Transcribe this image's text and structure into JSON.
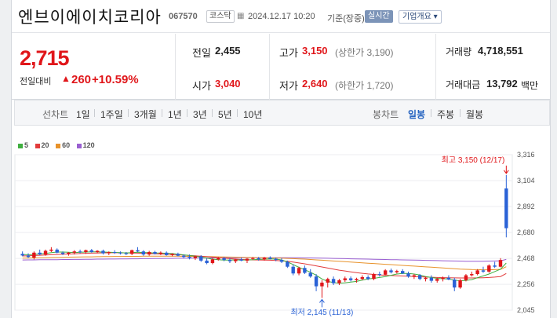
{
  "stock": {
    "name": "엔브이에이치코리아",
    "code": "067570",
    "market": "코스닥",
    "datetime": "2024.12.17 10:20",
    "basis": "기준(장중)",
    "realtime_label": "실시간",
    "corp_info_label": "기업개요 ▾"
  },
  "quote": {
    "price": "2,715",
    "change_label": "전일대비",
    "change_arrow": "▲",
    "change": "260",
    "change_pct": "+10.59%",
    "prev_close_label": "전일",
    "prev_close": "2,455",
    "open_label": "시가",
    "open": "3,040",
    "high_label": "고가",
    "high": "3,150",
    "upper_limit": "(상한가 3,190)",
    "low_label": "저가",
    "low": "2,640",
    "lower_limit": "(하한가 1,720)",
    "volume_label": "거래량",
    "volume": "4,718,551",
    "amount_label": "거래대금",
    "amount": "13,792",
    "amount_unit": "백만"
  },
  "period_bar": {
    "line_label": "선차트",
    "line_periods": [
      "1일",
      "1주일",
      "3개월",
      "1년",
      "3년",
      "5년",
      "10년"
    ],
    "candle_label": "봉차트",
    "candle_periods": [
      "일봉",
      "주봉",
      "월봉"
    ],
    "active_candle": "일봉"
  },
  "chart_data": {
    "type": "candlestick",
    "legend": [
      {
        "name": "5",
        "color": "#3fae3f"
      },
      {
        "name": "20",
        "color": "#e23b3b"
      },
      {
        "name": "60",
        "color": "#e8922a"
      },
      {
        "name": "120",
        "color": "#9a5fd1"
      }
    ],
    "y_ticks": [
      "3,316",
      "3,104",
      "2,892",
      "2,680",
      "2,468",
      "2,256",
      "2,045"
    ],
    "ylim": [
      2045,
      3316
    ],
    "max_annotation": "최고 3,150 (12/17)",
    "min_annotation": "최저 2,145 (11/13)",
    "up_color": "#e0161a",
    "down_color": "#2a62d6",
    "candles": [
      {
        "o": 2505,
        "h": 2525,
        "l": 2485,
        "c": 2492
      },
      {
        "o": 2492,
        "h": 2510,
        "l": 2470,
        "c": 2480
      },
      {
        "o": 2475,
        "h": 2525,
        "l": 2460,
        "c": 2515
      },
      {
        "o": 2515,
        "h": 2540,
        "l": 2495,
        "c": 2500
      },
      {
        "o": 2500,
        "h": 2540,
        "l": 2490,
        "c": 2530
      },
      {
        "o": 2530,
        "h": 2560,
        "l": 2520,
        "c": 2540
      },
      {
        "o": 2540,
        "h": 2550,
        "l": 2510,
        "c": 2515
      },
      {
        "o": 2515,
        "h": 2525,
        "l": 2495,
        "c": 2505
      },
      {
        "o": 2505,
        "h": 2520,
        "l": 2490,
        "c": 2515
      },
      {
        "o": 2515,
        "h": 2535,
        "l": 2500,
        "c": 2525
      },
      {
        "o": 2525,
        "h": 2540,
        "l": 2510,
        "c": 2520
      },
      {
        "o": 2520,
        "h": 2540,
        "l": 2505,
        "c": 2535
      },
      {
        "o": 2535,
        "h": 2545,
        "l": 2515,
        "c": 2520
      },
      {
        "o": 2520,
        "h": 2535,
        "l": 2510,
        "c": 2530
      },
      {
        "o": 2530,
        "h": 2540,
        "l": 2500,
        "c": 2510
      },
      {
        "o": 2510,
        "h": 2525,
        "l": 2495,
        "c": 2520
      },
      {
        "o": 2520,
        "h": 2535,
        "l": 2505,
        "c": 2515
      },
      {
        "o": 2515,
        "h": 2525,
        "l": 2500,
        "c": 2510
      },
      {
        "o": 2510,
        "h": 2520,
        "l": 2495,
        "c": 2505
      },
      {
        "o": 2505,
        "h": 2540,
        "l": 2495,
        "c": 2535
      },
      {
        "o": 2535,
        "h": 2560,
        "l": 2520,
        "c": 2525
      },
      {
        "o": 2525,
        "h": 2535,
        "l": 2490,
        "c": 2500
      },
      {
        "o": 2500,
        "h": 2530,
        "l": 2490,
        "c": 2520
      },
      {
        "o": 2520,
        "h": 2530,
        "l": 2500,
        "c": 2505
      },
      {
        "o": 2505,
        "h": 2525,
        "l": 2495,
        "c": 2515
      },
      {
        "o": 2515,
        "h": 2525,
        "l": 2490,
        "c": 2495
      },
      {
        "o": 2495,
        "h": 2510,
        "l": 2485,
        "c": 2505
      },
      {
        "o": 2505,
        "h": 2515,
        "l": 2485,
        "c": 2490
      },
      {
        "o": 2490,
        "h": 2500,
        "l": 2470,
        "c": 2480
      },
      {
        "o": 2480,
        "h": 2500,
        "l": 2460,
        "c": 2470
      },
      {
        "o": 2470,
        "h": 2490,
        "l": 2455,
        "c": 2485
      },
      {
        "o": 2485,
        "h": 2495,
        "l": 2440,
        "c": 2450
      },
      {
        "o": 2450,
        "h": 2470,
        "l": 2420,
        "c": 2430
      },
      {
        "o": 2430,
        "h": 2470,
        "l": 2420,
        "c": 2460
      },
      {
        "o": 2460,
        "h": 2480,
        "l": 2450,
        "c": 2470
      },
      {
        "o": 2470,
        "h": 2480,
        "l": 2445,
        "c": 2455
      },
      {
        "o": 2455,
        "h": 2470,
        "l": 2430,
        "c": 2445
      },
      {
        "o": 2445,
        "h": 2465,
        "l": 2430,
        "c": 2460
      },
      {
        "o": 2460,
        "h": 2475,
        "l": 2445,
        "c": 2450
      },
      {
        "o": 2450,
        "h": 2470,
        "l": 2430,
        "c": 2465
      },
      {
        "o": 2465,
        "h": 2480,
        "l": 2455,
        "c": 2470
      },
      {
        "o": 2470,
        "h": 2480,
        "l": 2450,
        "c": 2460
      },
      {
        "o": 2460,
        "h": 2480,
        "l": 2450,
        "c": 2475
      },
      {
        "o": 2475,
        "h": 2485,
        "l": 2460,
        "c": 2465
      },
      {
        "o": 2465,
        "h": 2475,
        "l": 2445,
        "c": 2455
      },
      {
        "o": 2455,
        "h": 2470,
        "l": 2430,
        "c": 2440
      },
      {
        "o": 2440,
        "h": 2450,
        "l": 2390,
        "c": 2400
      },
      {
        "o": 2400,
        "h": 2420,
        "l": 2330,
        "c": 2345
      },
      {
        "o": 2345,
        "h": 2400,
        "l": 2330,
        "c": 2390
      },
      {
        "o": 2390,
        "h": 2410,
        "l": 2340,
        "c": 2350
      },
      {
        "o": 2350,
        "h": 2380,
        "l": 2310,
        "c": 2320
      },
      {
        "o": 2320,
        "h": 2340,
        "l": 2200,
        "c": 2240
      },
      {
        "o": 2240,
        "h": 2290,
        "l": 2145,
        "c": 2270
      },
      {
        "o": 2270,
        "h": 2310,
        "l": 2230,
        "c": 2300
      },
      {
        "o": 2300,
        "h": 2320,
        "l": 2250,
        "c": 2265
      },
      {
        "o": 2265,
        "h": 2300,
        "l": 2250,
        "c": 2290
      },
      {
        "o": 2290,
        "h": 2320,
        "l": 2275,
        "c": 2305
      },
      {
        "o": 2305,
        "h": 2320,
        "l": 2280,
        "c": 2290
      },
      {
        "o": 2290,
        "h": 2310,
        "l": 2270,
        "c": 2300
      },
      {
        "o": 2300,
        "h": 2330,
        "l": 2290,
        "c": 2315
      },
      {
        "o": 2315,
        "h": 2330,
        "l": 2290,
        "c": 2300
      },
      {
        "o": 2300,
        "h": 2350,
        "l": 2290,
        "c": 2340
      },
      {
        "o": 2340,
        "h": 2360,
        "l": 2320,
        "c": 2335
      },
      {
        "o": 2335,
        "h": 2380,
        "l": 2330,
        "c": 2370
      },
      {
        "o": 2370,
        "h": 2385,
        "l": 2345,
        "c": 2355
      },
      {
        "o": 2355,
        "h": 2375,
        "l": 2345,
        "c": 2365
      },
      {
        "o": 2365,
        "h": 2380,
        "l": 2340,
        "c": 2345
      },
      {
        "o": 2345,
        "h": 2360,
        "l": 2310,
        "c": 2320
      },
      {
        "o": 2320,
        "h": 2340,
        "l": 2300,
        "c": 2330
      },
      {
        "o": 2330,
        "h": 2340,
        "l": 2290,
        "c": 2300
      },
      {
        "o": 2300,
        "h": 2320,
        "l": 2280,
        "c": 2310
      },
      {
        "o": 2310,
        "h": 2330,
        "l": 2270,
        "c": 2285
      },
      {
        "o": 2285,
        "h": 2310,
        "l": 2270,
        "c": 2300
      },
      {
        "o": 2300,
        "h": 2320,
        "l": 2280,
        "c": 2310
      },
      {
        "o": 2310,
        "h": 2330,
        "l": 2290,
        "c": 2295
      },
      {
        "o": 2295,
        "h": 2310,
        "l": 2200,
        "c": 2230
      },
      {
        "o": 2230,
        "h": 2300,
        "l": 2220,
        "c": 2290
      },
      {
        "o": 2290,
        "h": 2340,
        "l": 2280,
        "c": 2330
      },
      {
        "o": 2330,
        "h": 2360,
        "l": 2320,
        "c": 2340
      },
      {
        "o": 2340,
        "h": 2380,
        "l": 2330,
        "c": 2370
      },
      {
        "o": 2370,
        "h": 2400,
        "l": 2350,
        "c": 2360
      },
      {
        "o": 2360,
        "h": 2420,
        "l": 2350,
        "c": 2410
      },
      {
        "o": 2410,
        "h": 2440,
        "l": 2390,
        "c": 2400
      },
      {
        "o": 2400,
        "h": 2470,
        "l": 2395,
        "c": 2455
      },
      {
        "o": 3040,
        "h": 3150,
        "l": 2640,
        "c": 2715
      }
    ],
    "ma5": [
      2500,
      2498,
      2500,
      2505,
      2508,
      2515,
      2520,
      2520,
      2518,
      2515,
      2518,
      2520,
      2522,
      2522,
      2520,
      2518,
      2517,
      2515,
      2513,
      2515,
      2518,
      2516,
      2514,
      2512,
      2512,
      2510,
      2508,
      2502,
      2497,
      2492,
      2486,
      2478,
      2470,
      2462,
      2458,
      2454,
      2455,
      2456,
      2455,
      2455,
      2458,
      2460,
      2462,
      2464,
      2463,
      2455,
      2440,
      2418,
      2395,
      2375,
      2355,
      2330,
      2300,
      2280,
      2270,
      2265,
      2268,
      2274,
      2280,
      2290,
      2300,
      2305,
      2312,
      2320,
      2330,
      2340,
      2345,
      2345,
      2340,
      2332,
      2320,
      2312,
      2305,
      2302,
      2300,
      2290,
      2285,
      2288,
      2295,
      2310,
      2325,
      2340,
      2360,
      2380,
      2430
    ],
    "ma20": [
      2488,
      2490,
      2492,
      2494,
      2496,
      2498,
      2500,
      2502,
      2504,
      2506,
      2508,
      2510,
      2511,
      2512,
      2513,
      2514,
      2514,
      2514,
      2513,
      2512,
      2511,
      2510,
      2508,
      2506,
      2504,
      2502,
      2500,
      2498,
      2495,
      2492,
      2489,
      2486,
      2482,
      2478,
      2474,
      2470,
      2466,
      2463,
      2460,
      2458,
      2456,
      2455,
      2454,
      2453,
      2451,
      2448,
      2444,
      2438,
      2431,
      2424,
      2416,
      2407,
      2398,
      2389,
      2380,
      2372,
      2365,
      2358,
      2352,
      2346,
      2341,
      2337,
      2333,
      2330,
      2328,
      2326,
      2324,
      2322,
      2320,
      2318,
      2316,
      2314,
      2312,
      2311,
      2310,
      2309,
      2308,
      2308,
      2308,
      2309,
      2310,
      2312,
      2315,
      2320,
      2345
    ],
    "ma60": [
      2470,
      2471,
      2472,
      2473,
      2474,
      2475,
      2476,
      2477,
      2478,
      2479,
      2480,
      2481,
      2481,
      2482,
      2483,
      2483,
      2484,
      2484,
      2485,
      2485,
      2485,
      2486,
      2486,
      2486,
      2486,
      2486,
      2486,
      2486,
      2485,
      2485,
      2484,
      2484,
      2483,
      2482,
      2481,
      2480,
      2479,
      2478,
      2477,
      2476,
      2475,
      2474,
      2473,
      2472,
      2471,
      2470,
      2468,
      2466,
      2464,
      2462,
      2459,
      2456,
      2453,
      2450,
      2447,
      2444,
      2441,
      2438,
      2435,
      2432,
      2429,
      2426,
      2423,
      2420,
      2417,
      2414,
      2411,
      2408,
      2405,
      2402,
      2399,
      2396,
      2393,
      2390,
      2387,
      2384,
      2381,
      2379,
      2377,
      2376,
      2375,
      2375,
      2376,
      2378,
      2400
    ],
    "ma120": [
      2455,
      2456,
      2456,
      2457,
      2457,
      2458,
      2458,
      2459,
      2459,
      2460,
      2460,
      2461,
      2461,
      2462,
      2462,
      2463,
      2463,
      2464,
      2464,
      2465,
      2465,
      2466,
      2466,
      2467,
      2467,
      2468,
      2468,
      2469,
      2469,
      2470,
      2470,
      2471,
      2471,
      2472,
      2472,
      2473,
      2473,
      2473,
      2474,
      2474,
      2474,
      2474,
      2474,
      2474,
      2474,
      2474,
      2474,
      2473,
      2473,
      2472,
      2472,
      2471,
      2470,
      2469,
      2468,
      2467,
      2466,
      2465,
      2464,
      2463,
      2462,
      2461,
      2460,
      2459,
      2458,
      2457,
      2456,
      2455,
      2454,
      2453,
      2452,
      2451,
      2450,
      2449,
      2448,
      2447,
      2446,
      2445,
      2445,
      2445,
      2445,
      2446,
      2447,
      2448,
      2460
    ]
  }
}
